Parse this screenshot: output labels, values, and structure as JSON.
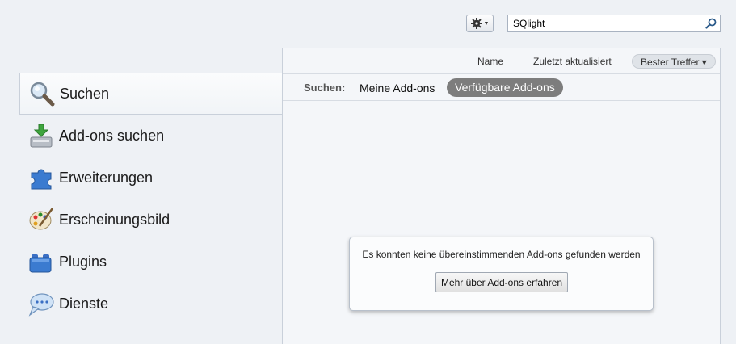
{
  "toolbar": {
    "gear_icon": "gear-icon",
    "search": {
      "value": "SQlight",
      "icon": "search-icon"
    }
  },
  "sidebar": {
    "items": [
      {
        "label": "Suchen",
        "icon": "magnifier-icon",
        "selected": true
      },
      {
        "label": "Add-ons suchen",
        "icon": "download-icon",
        "selected": false
      },
      {
        "label": "Erweiterungen",
        "icon": "puzzle-icon",
        "selected": false
      },
      {
        "label": "Erscheinungsbild",
        "icon": "palette-icon",
        "selected": false
      },
      {
        "label": "Plugins",
        "icon": "plugin-block-icon",
        "selected": false
      },
      {
        "label": "Dienste",
        "icon": "speech-bubble-icon",
        "selected": false
      }
    ]
  },
  "sort": {
    "name": "Name",
    "last_updated": "Zuletzt aktualisiert",
    "best_match": "Bester Treffer ▾"
  },
  "filter": {
    "label": "Suchen:",
    "my_addons": "Meine Add-ons",
    "available_addons": "Verfügbare Add-ons",
    "selected": "available_addons"
  },
  "empty": {
    "message": "Es konnten keine übereinstimmenden Add-ons gefunden werden",
    "button": "Mehr über Add-ons erfahren"
  },
  "colors": {
    "background": "#eef1f5",
    "selected_pill": "#7d7d7d",
    "border": "#c9d0da"
  }
}
